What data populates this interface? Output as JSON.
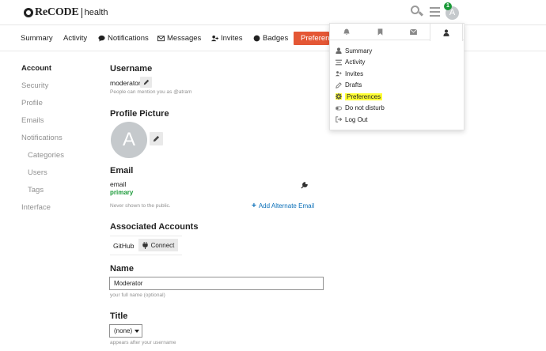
{
  "header": {
    "logo_main": "ReCODE",
    "logo_sub": "health",
    "avatar_letter": "A",
    "notification_count": "1"
  },
  "tabs": [
    {
      "label": "Summary"
    },
    {
      "label": "Activity"
    },
    {
      "label": "Notifications"
    },
    {
      "label": "Messages"
    },
    {
      "label": "Invites"
    },
    {
      "label": "Badges"
    },
    {
      "label": "Preferences"
    }
  ],
  "sidebar": {
    "items": [
      {
        "label": "Account",
        "active": true
      },
      {
        "label": "Security"
      },
      {
        "label": "Profile"
      },
      {
        "label": "Emails"
      },
      {
        "label": "Notifications"
      },
      {
        "label": "Categories"
      },
      {
        "label": "Users"
      },
      {
        "label": "Tags"
      },
      {
        "label": "Interface"
      }
    ]
  },
  "account": {
    "username_title": "Username",
    "username_value": "moderator",
    "username_hint": "People can mention you as @atram",
    "profile_picture_title": "Profile Picture",
    "avatar_letter": "A",
    "email_title": "Email",
    "email_value": "email",
    "email_primary": "primary",
    "email_hint": "Never shown to the public.",
    "add_email_label": "Add Alternate Email",
    "associated_title": "Associated Accounts",
    "associated_provider": "GitHub",
    "connect_label": "Connect",
    "name_title": "Name",
    "name_value": "Moderator",
    "name_hint": "your full name (optional)",
    "title_title": "Title",
    "title_value": "(none)",
    "title_hint": "appears after your username"
  },
  "user_menu": {
    "items": [
      {
        "label": "Summary",
        "icon": "user-icon"
      },
      {
        "label": "Activity",
        "icon": "stream-icon"
      },
      {
        "label": "Invites",
        "icon": "user-plus-icon"
      },
      {
        "label": "Drafts",
        "icon": "pencil-icon"
      },
      {
        "label": "Preferences",
        "icon": "cog-icon",
        "highlighted": true
      },
      {
        "label": "Do not disturb",
        "icon": "toggle-icon"
      },
      {
        "label": "Log Out",
        "icon": "sign-out-icon"
      }
    ]
  },
  "colors": {
    "accent": "#e45735",
    "primary_green": "#1a9a38",
    "link_blue": "#0a6fb8",
    "highlight_yellow": "#ffff33",
    "muted": "#919191"
  }
}
